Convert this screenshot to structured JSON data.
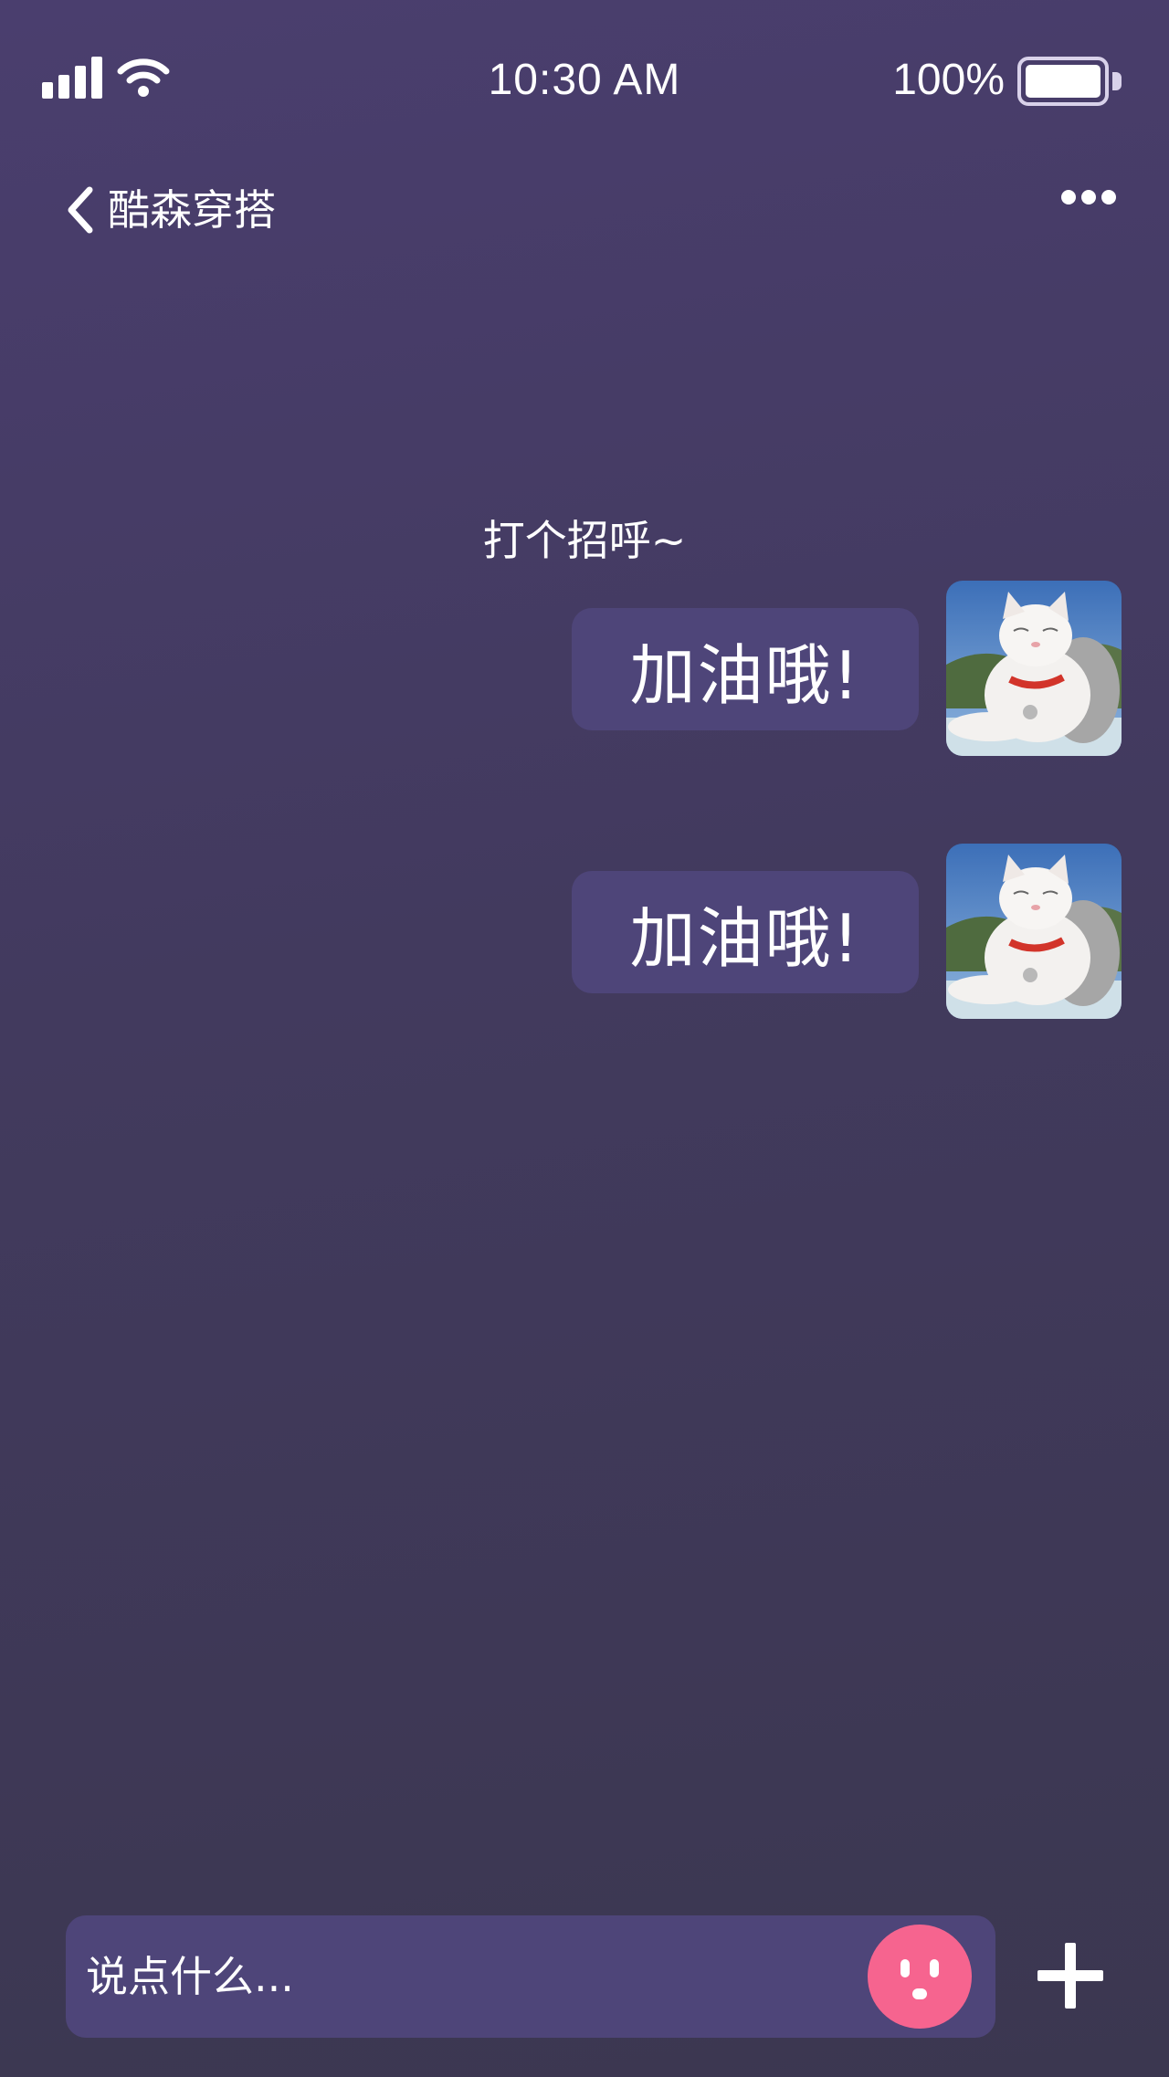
{
  "status_bar": {
    "time": "10:30 AM",
    "battery_percent": "100%",
    "battery_level": 1.0,
    "signal_icon": "cellular-signal-icon",
    "wifi_icon": "wifi-icon"
  },
  "nav": {
    "back_icon": "chevron-left-icon",
    "title": "酷森穿搭",
    "more_icon": "more-dots-icon"
  },
  "chat": {
    "greeting": "打个招呼~",
    "messages": [
      {
        "text": "加油哦!",
        "sender": "self",
        "avatar": "cat-avatar"
      },
      {
        "text": "加油哦!",
        "sender": "self",
        "avatar": "cat-avatar"
      }
    ]
  },
  "input_bar": {
    "placeholder": "说点什么...",
    "emoji_icon": "emoji-face-icon",
    "plus_icon": "plus-icon"
  },
  "colors": {
    "background_top": "#4a3e6e",
    "background_bottom": "#3b3750",
    "bubble": "#4e4579",
    "emoji_button": "#f6648f"
  }
}
